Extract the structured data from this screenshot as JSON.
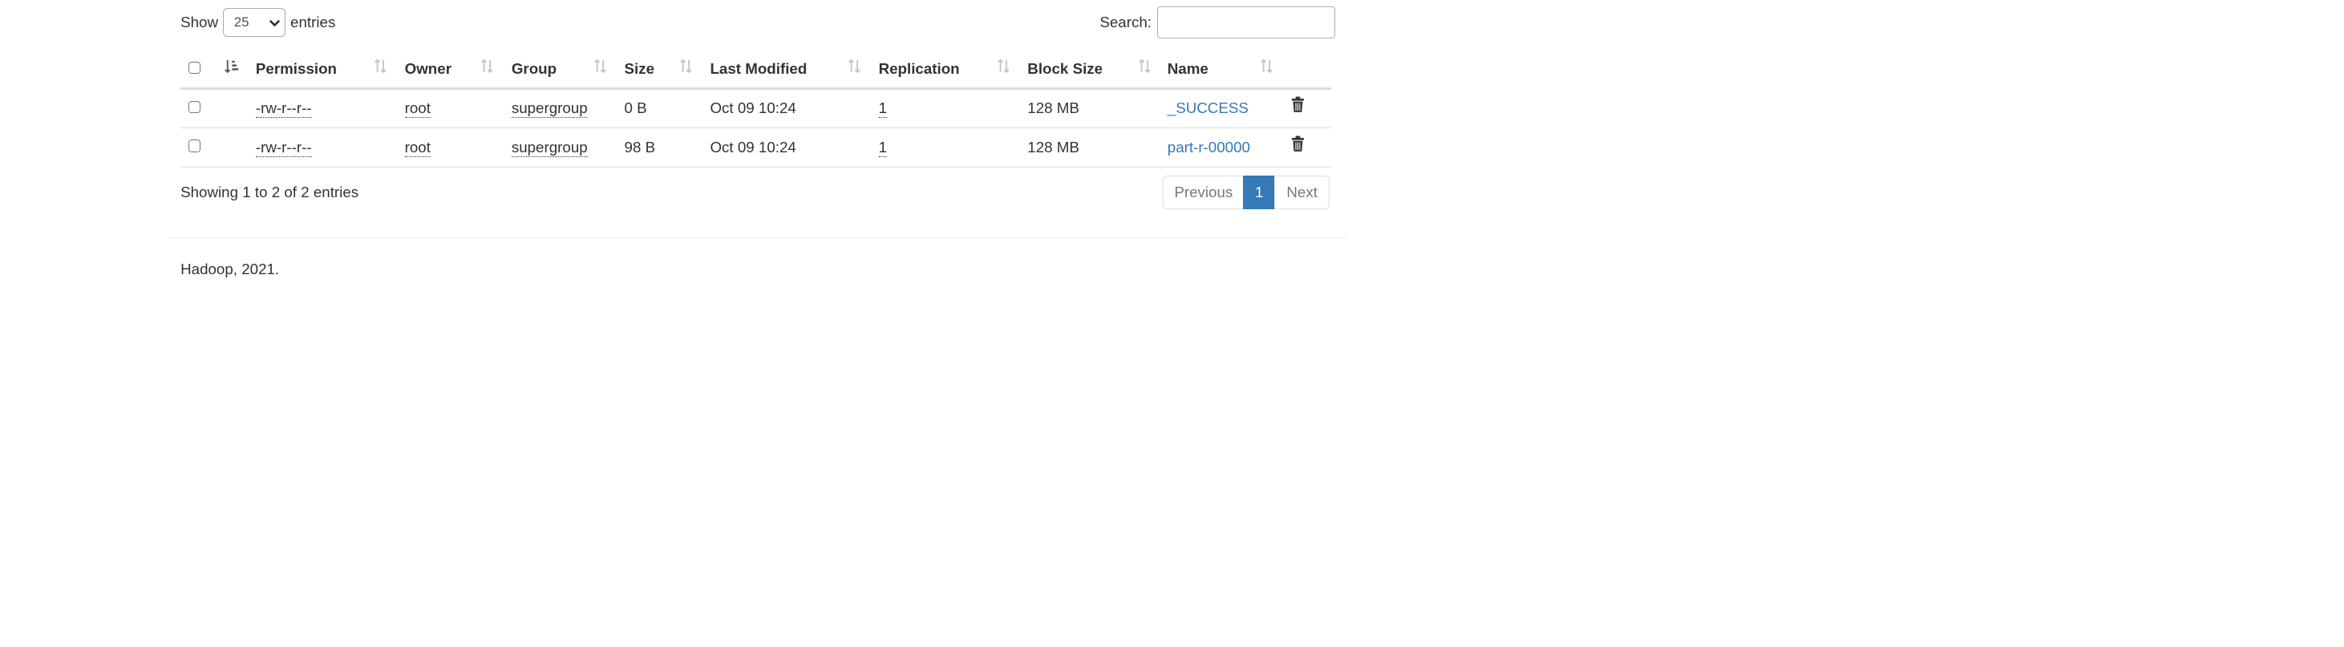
{
  "length_control": {
    "show_label": "Show",
    "selected": "25",
    "entries_label": "entries"
  },
  "search": {
    "label": "Search:",
    "value": "",
    "placeholder": ""
  },
  "table": {
    "columns": [
      "Permission",
      "Owner",
      "Group",
      "Size",
      "Last Modified",
      "Replication",
      "Block Size",
      "Name"
    ],
    "rows": [
      {
        "permission": "-rw-r--r--",
        "owner": "root",
        "group": "supergroup",
        "size": "0 B",
        "last_modified": "Oct 09 10:24",
        "replication": "1",
        "block_size": "128 MB",
        "name": "_SUCCESS"
      },
      {
        "permission": "-rw-r--r--",
        "owner": "root",
        "group": "supergroup",
        "size": "98 B",
        "last_modified": "Oct 09 10:24",
        "replication": "1",
        "block_size": "128 MB",
        "name": "part-r-00000"
      }
    ]
  },
  "info": "Showing 1 to 2 of 2 entries",
  "pagination": {
    "previous": "Previous",
    "current": "1",
    "next": "Next"
  },
  "footer": "Hadoop, 2021.",
  "icons": {
    "sort_asc": "sort-ascending-icon",
    "sort": "sort-both-icon",
    "delete": "trash-icon",
    "dropdown": "chevron-down-icon"
  },
  "colors": {
    "link": "#337ab7",
    "active_page": "#337ab7",
    "border": "#dddddd",
    "text": "#333333"
  }
}
